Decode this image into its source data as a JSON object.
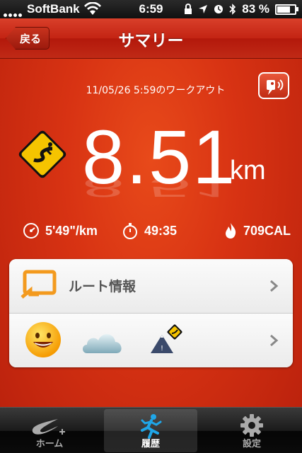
{
  "status_bar": {
    "carrier": "SoftBank",
    "time": "6:59",
    "battery_percent": "83 %",
    "battery_level": 0.83
  },
  "nav": {
    "back_label": "戻る",
    "title": "サマリー"
  },
  "workout": {
    "date_label": "11/05/26 5:59のワークアウト",
    "distance": "8.51",
    "unit": "km",
    "pace": "5'49\"/km",
    "duration": "49:35",
    "calories": "709CAL"
  },
  "panel": {
    "route_label": "ルート情報",
    "mood_icon": "smiley-icon",
    "weather_icon": "cloud-icon",
    "terrain_icon": "trail-terrain-icon"
  },
  "tabs": [
    {
      "label": "ホーム",
      "icon": "nike-plus-icon",
      "selected": false
    },
    {
      "label": "履歴",
      "icon": "runner-icon",
      "selected": true
    },
    {
      "label": "設定",
      "icon": "gear-icon",
      "selected": false
    }
  ],
  "colors": {
    "accent": "#d83313",
    "sign_yellow": "#f5c400",
    "route_orange": "#f39a1e"
  }
}
